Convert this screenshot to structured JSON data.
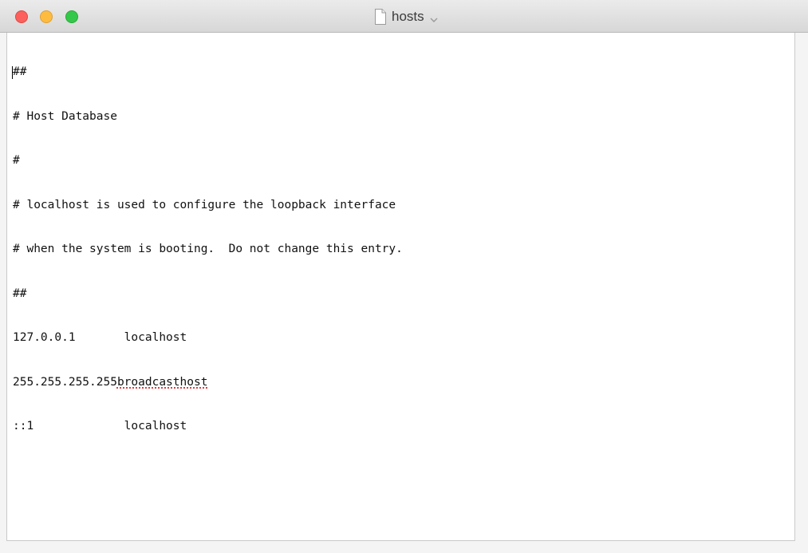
{
  "window": {
    "title": "hosts",
    "title_icon": "document-icon",
    "title_menu_icon": "chevron-down-icon",
    "traffic_lights": {
      "close_color": "#fc605c",
      "minimize_color": "#fdbc40",
      "zoom_color": "#34c84a"
    }
  },
  "editor": {
    "lines": [
      "##",
      "# Host Database",
      "#",
      "# localhost is used to configure the loopback interface",
      "# when the system is booting.  Do not change this entry.",
      "##",
      "127.0.0.1       localhost",
      "255.255.255.255",
      "broadcasthost",
      "::1             localhost"
    ]
  }
}
